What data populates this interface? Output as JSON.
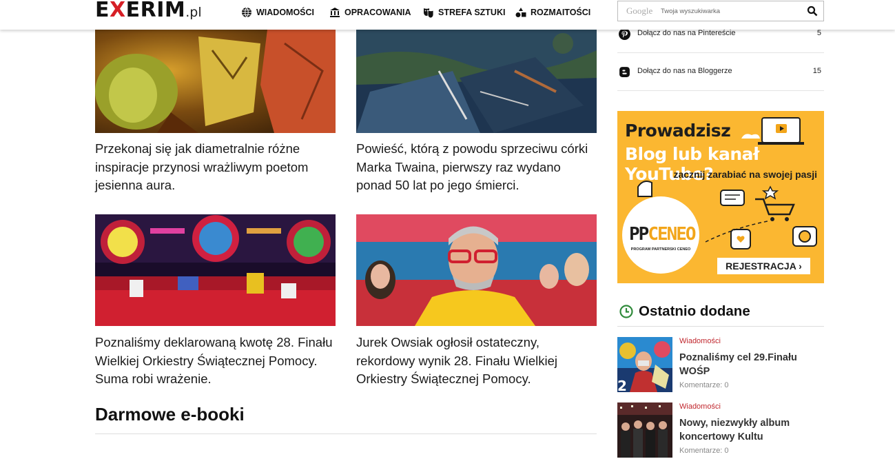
{
  "header": {
    "logo_main": "EXERIM",
    "logo_tld": ".pl",
    "nav": [
      {
        "label": "WIADOMOŚCI",
        "icon": "globe-icon"
      },
      {
        "label": "OPRACOWANIA",
        "icon": "institution-icon"
      },
      {
        "label": "STREFA SZTUKI",
        "icon": "theater-masks-icon"
      },
      {
        "label": "ROZMAITOŚCI",
        "icon": "shapes-icon"
      }
    ],
    "search": {
      "brand": "Google",
      "placeholder": "Twoja wyszukiwarka"
    }
  },
  "articles": [
    {
      "title": "Przekonaj się jak diametralnie różne inspiracje przynosi wrażliwym poetom jesienna aura."
    },
    {
      "title": "Powieść, którą z powodu sprzeciwu córki Marka Twaina, pierwszy raz wydano ponad 50 lat po jego śmierci."
    },
    {
      "title": "Poznaliśmy deklarowaną kwotę 28. Finału Wielkiej Orkiestry Świątecznej Pomocy. Suma robi wrażenie."
    },
    {
      "title": "Jurek Owsiak ogłosił ostateczny, rekordowy wynik 28. Finału Wielkiej Orkiestry Świątecznej Pomocy."
    }
  ],
  "section": {
    "title": "Darmowe e-booki"
  },
  "sidebar": {
    "social": [
      {
        "label": "Dołącz do nas na Pintereście",
        "count": "5",
        "icon": "pinterest-icon"
      },
      {
        "label": "Dołącz do nas na Bloggerze",
        "count": "15",
        "icon": "blogger-icon"
      }
    ],
    "ad": {
      "line1": "Prowadzisz",
      "line2": "Blog lub kanał YouTube?",
      "line3": "zacznij zarabiać na swojej pasji",
      "brand_pp": "PP",
      "brand_ceneo": "CENEO",
      "brand_sub": "PROGRAM PARTNERSKI CENEO",
      "button": "REJESTRACJA ›"
    },
    "recent": {
      "title": "Ostatnio dodane",
      "items": [
        {
          "category": "Wiadomości",
          "title": "Poznaliśmy cel 29.Finału WOŚP",
          "comments": "Komentarze: 0"
        },
        {
          "category": "Wiadomości",
          "title": "Nowy, niezwykły album koncertowy Kultu",
          "comments": "Komentarze: 0"
        }
      ]
    }
  },
  "colors": {
    "accent": "#d61f26",
    "ad_bg": "#fbb731",
    "recent_icon": "#2f8a3a"
  }
}
